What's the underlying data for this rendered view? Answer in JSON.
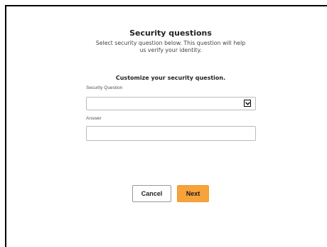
{
  "dialog": {
    "title": "Security questions",
    "subtitle": "Select security question below. This question will help us verify your identity.",
    "customize_heading": "Customize your security question."
  },
  "form": {
    "security_question": {
      "label": "Security Question",
      "selected_value": ""
    },
    "answer": {
      "label": "Answer",
      "value": ""
    }
  },
  "buttons": {
    "cancel_label": "Cancel",
    "next_label": "Next"
  },
  "colors": {
    "accent": "#f7a23a",
    "frame_border": "#000000"
  },
  "icons": {
    "select_toggle": "chevron-down-icon"
  }
}
